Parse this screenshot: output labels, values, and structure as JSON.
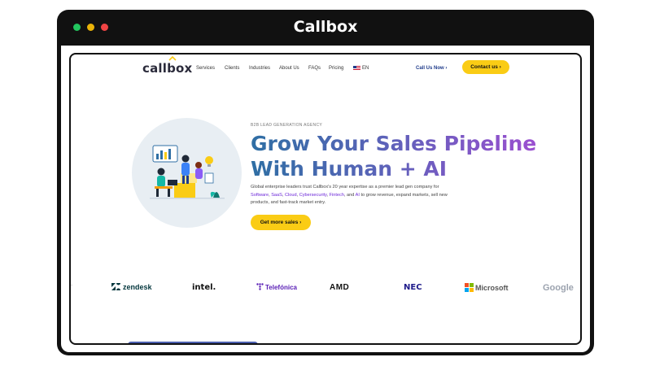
{
  "window": {
    "title": "Callbox"
  },
  "nav": {
    "logo": "callbox",
    "items": [
      "Services",
      "Clients",
      "Industries",
      "About Us",
      "FAQs",
      "Pricing"
    ],
    "language": "EN",
    "call_link": "Call Us Now  ›",
    "contact_button": "Contact us  ›"
  },
  "hero": {
    "eyebrow": "B2B LEAD GENERATION AGENCY",
    "headline_line1": "Grow Your Sales Pipeline",
    "headline_line2": "With Human + AI",
    "description_parts": [
      "Global enterprise leaders trust Callbox's 20 year expertise as a premier lead gen company for ",
      "Software",
      ", ",
      "SaaS",
      ", ",
      "Cloud",
      ", ",
      "Cybersecurity",
      ", ",
      "Fintech",
      ", and ",
      "AI",
      " to grow revenue, expand markets, sell new products, and fast-track market entry."
    ],
    "cta_button": "Get more sales  ›"
  },
  "clients": {
    "partial": "-",
    "logos": [
      "zendesk",
      "intel.",
      "Telefónica",
      "AMD",
      "NEC",
      "Microsoft",
      "Google"
    ]
  },
  "colors": {
    "accent_yellow": "#facc15",
    "headline_start": "#2f6fa4",
    "headline_end": "#9b4fd0",
    "nav_blue": "#1e3a8a"
  },
  "icons": {
    "window_dots": [
      "green-dot",
      "yellow-dot",
      "red-dot"
    ],
    "hero_illustration": "team-growth-illustration"
  }
}
